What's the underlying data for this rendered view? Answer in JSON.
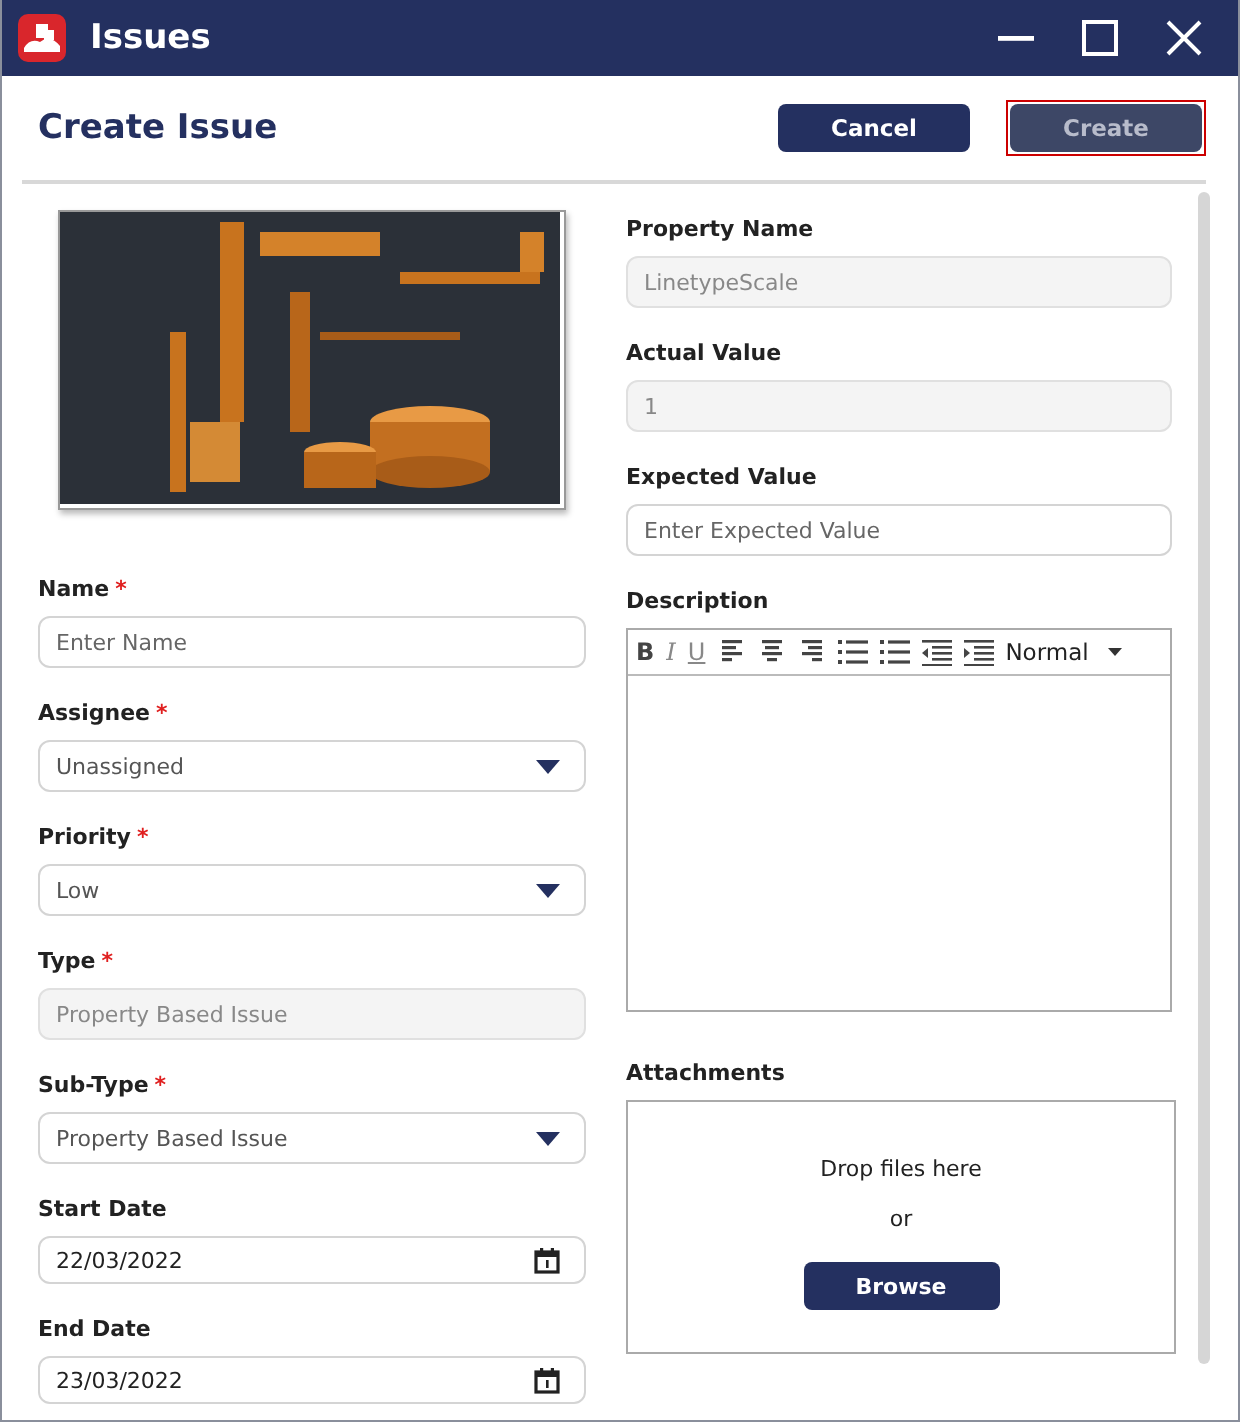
{
  "window": {
    "title": "Issues"
  },
  "header": {
    "title": "Create Issue",
    "buttons": [
      {
        "label": "Cancel",
        "disabled": false,
        "focused": false
      },
      {
        "label": "Create",
        "disabled": true,
        "focused": true
      }
    ]
  },
  "left_fields": [
    {
      "label": "Name",
      "required_mark": "*",
      "kind": "text",
      "placeholder": "Enter Name",
      "readonly": false
    },
    {
      "label": "Assignee",
      "required_mark": "*",
      "kind": "select",
      "value": "Unassigned"
    },
    {
      "label": "Priority",
      "required_mark": "*",
      "kind": "select",
      "value": "Low"
    },
    {
      "label": "Type",
      "required_mark": "*",
      "kind": "text",
      "value": "Property Based Issue",
      "readonly": true
    },
    {
      "label": "Sub-Type",
      "required_mark": "*",
      "kind": "select",
      "value": "Property Based Issue"
    },
    {
      "label": "Start Date",
      "kind": "date",
      "value": "22/03/2022"
    },
    {
      "label": "End Date",
      "kind": "date",
      "value": "23/03/2022"
    }
  ],
  "right_fields": [
    {
      "label": "Property Name",
      "kind": "text",
      "value": "LinetypeScale",
      "readonly": true
    },
    {
      "label": "Actual Value",
      "kind": "text",
      "value": "1",
      "readonly": true
    },
    {
      "label": "Expected Value",
      "kind": "text",
      "placeholder": "Enter Expected Value",
      "readonly": false
    }
  ],
  "description": {
    "label": "Description",
    "toolbar": [
      {
        "kind": "bold",
        "label": "B"
      },
      {
        "kind": "italic",
        "label": "I"
      },
      {
        "kind": "underline",
        "label": "U"
      },
      {
        "kind": "align-left"
      },
      {
        "kind": "align-center"
      },
      {
        "kind": "align-right"
      },
      {
        "kind": "ordered-list"
      },
      {
        "kind": "bullet-list"
      },
      {
        "kind": "outdent"
      },
      {
        "kind": "indent"
      },
      {
        "kind": "format",
        "label": "Normal"
      }
    ]
  },
  "attachments": {
    "label": "Attachments",
    "drop_text": "Drop files here",
    "separator": "or",
    "button": "Browse"
  }
}
